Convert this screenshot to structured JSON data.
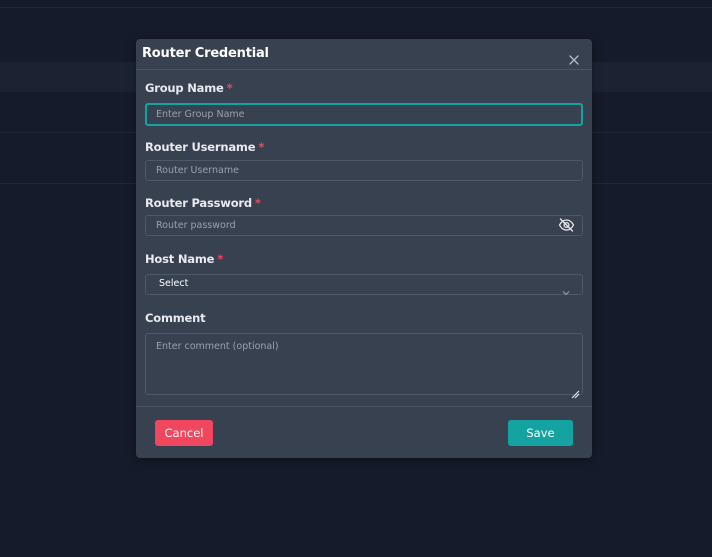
{
  "modal": {
    "title": "Router Credential",
    "required_mark": "*",
    "fields": {
      "group_name": {
        "label": "Group Name",
        "placeholder": "Enter Group Name",
        "value": ""
      },
      "router_username": {
        "label": "Router Username",
        "placeholder": "Router Username",
        "value": ""
      },
      "router_password": {
        "label": "Router Password",
        "placeholder": "Router password",
        "value": ""
      },
      "host_name": {
        "label": "Host Name",
        "selected": "Select"
      },
      "comment": {
        "label": "Comment",
        "placeholder": "Enter comment (optional)",
        "value": ""
      }
    },
    "buttons": {
      "cancel": "Cancel",
      "save": "Save"
    }
  },
  "icons": {
    "close": "close-icon",
    "password_toggle": "eye-slash-icon",
    "dropdown": "chevron-down-icon",
    "resize": "resize-handle-icon"
  },
  "colors": {
    "background": "#151b2a",
    "modal_background": "#384150",
    "accent": "#14a3a0",
    "danger": "#f0465e",
    "required": "#f0465e"
  }
}
